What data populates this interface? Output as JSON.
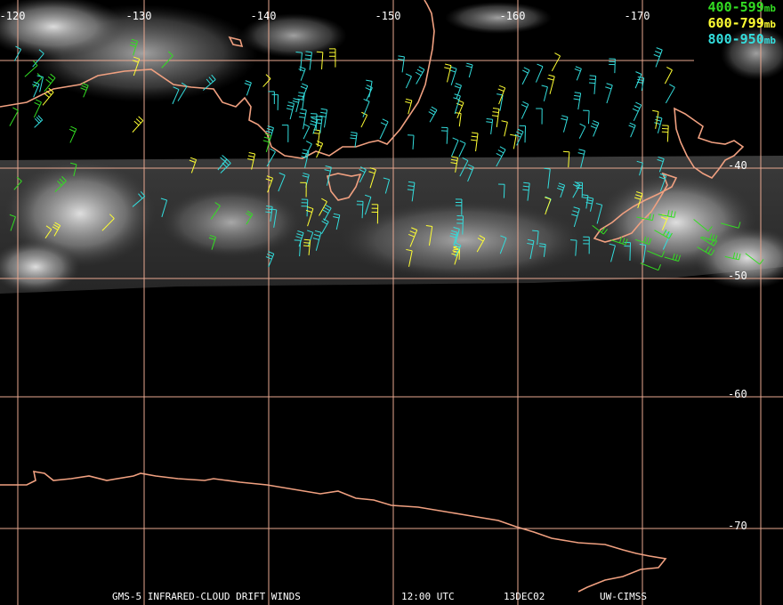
{
  "map": {
    "longitude_labels": [
      "-120",
      "-130",
      "-140",
      "-150",
      "-160",
      "-170"
    ],
    "latitude_labels": [
      "-40",
      "-50",
      "-60",
      "-70"
    ]
  },
  "legend": [
    {
      "range": "400-599",
      "unit": "mb",
      "color": "#33dd22"
    },
    {
      "range": "600-799",
      "unit": "mb",
      "color": "#ffff33"
    },
    {
      "range": "800-950",
      "unit": "mb",
      "color": "#33dddd"
    }
  ],
  "footer": {
    "product": "GMS-5 INFRARED-CLOUD DRIFT WINDS",
    "time": "12:00 UTC",
    "date": "13DEC02",
    "source": "UW-CIMSS"
  },
  "colors": {
    "grid": "#e8a890",
    "coast": "#f0a080",
    "background": "#000000"
  }
}
